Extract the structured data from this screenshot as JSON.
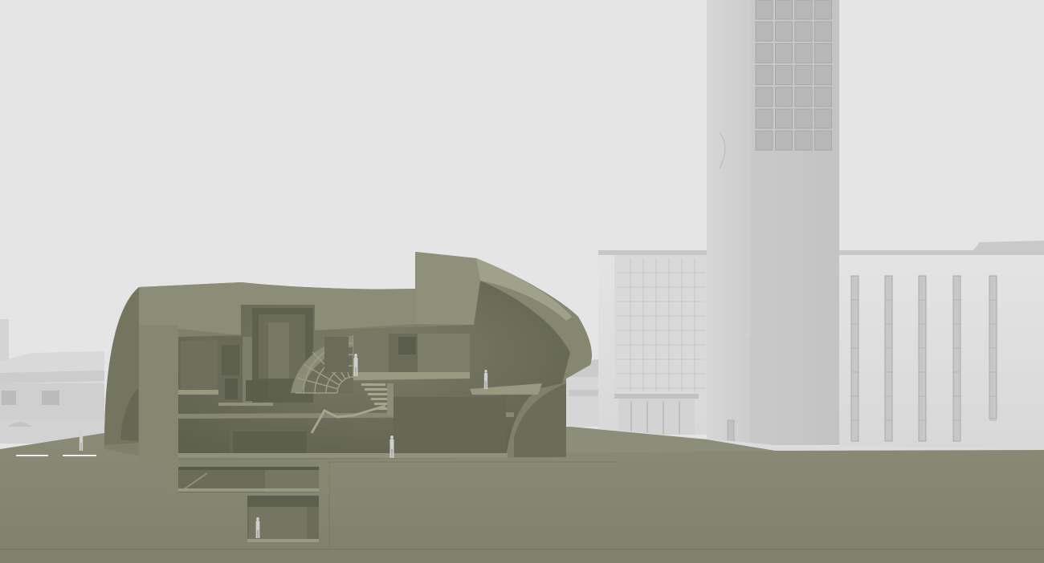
{
  "scene": {
    "kind": "architectural-section-render",
    "colors": {
      "sky": "#e5e5e5",
      "ground": "#858671",
      "ground_edge": "#6f705d",
      "section_wall": "#7e806a",
      "interior": "#707260",
      "interior_dark": "#5f614f",
      "surface_light": "#9a9c84",
      "floor_slab": "#8e9078",
      "church_light": "#e0e0e0",
      "church_mid": "#cfcfcf",
      "church_shadow": "#bdbdbd",
      "glass": "#b7b7b7",
      "human_figure": "#cfcfcf"
    },
    "objects": {
      "background_houses": "left-neighbour-buildings",
      "tower": "church-bell-tower",
      "nave": "church-nave",
      "annex": "church-annex",
      "section": "curved-section-building",
      "basement": "underground-levels",
      "people": "human-figures"
    }
  }
}
